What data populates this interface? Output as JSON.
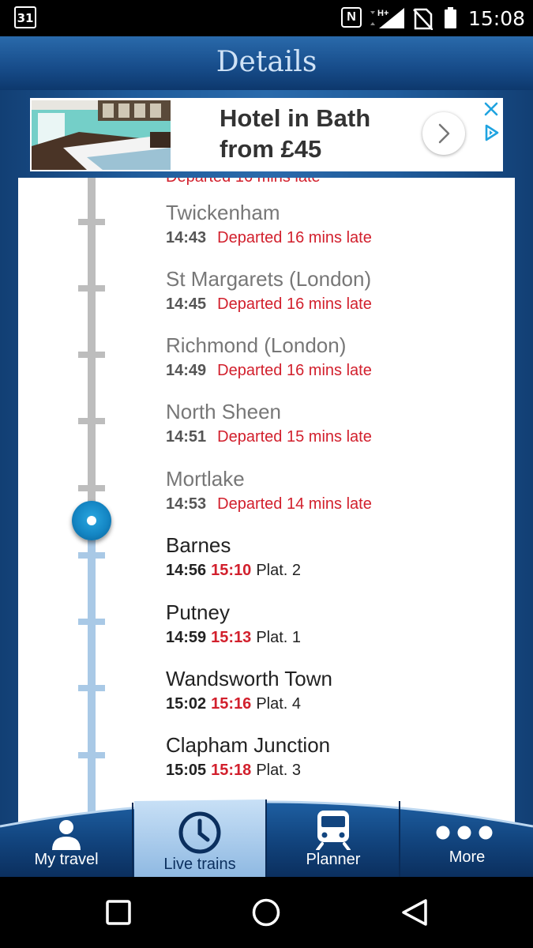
{
  "status_bar": {
    "calendar_day": "31",
    "nfc_letter": "N",
    "network_type": "H+",
    "time": "15:08"
  },
  "header": {
    "title": "Details"
  },
  "ad": {
    "headline_line1": "Hotel in Bath",
    "headline_line2": "from £45",
    "icons": [
      "hotel-room-photo",
      "chevron-right-icon",
      "close-icon",
      "adchoices-icon"
    ]
  },
  "timeline": {
    "cut_off_text": "Departed 16 mins late",
    "past_stops": [
      {
        "name": "Twickenham",
        "time": "14:43",
        "status": "Departed 16 mins late"
      },
      {
        "name": "St Margarets (London)",
        "time": "14:45",
        "status": "Departed 16 mins late"
      },
      {
        "name": "Richmond (London)",
        "time": "14:49",
        "status": "Departed 16 mins late"
      },
      {
        "name": "North Sheen",
        "time": "14:51",
        "status": "Departed 15 mins late"
      },
      {
        "name": "Mortlake",
        "time": "14:53",
        "status": "Departed 14 mins late"
      }
    ],
    "future_stops": [
      {
        "name": "Barnes",
        "scheduled": "14:56",
        "expected": "15:10",
        "platform": "Plat. 2"
      },
      {
        "name": "Putney",
        "scheduled": "14:59",
        "expected": "15:13",
        "platform": "Plat. 1"
      },
      {
        "name": "Wandsworth Town",
        "scheduled": "15:02",
        "expected": "15:16",
        "platform": "Plat. 4"
      },
      {
        "name": "Clapham Junction",
        "scheduled": "15:05",
        "expected": "15:18",
        "platform": "Plat. 3"
      }
    ],
    "colors": {
      "past_line": "#bdbdbd",
      "future_line": "#a9c9e6",
      "late": "#d2202d"
    }
  },
  "tabs": [
    {
      "label": "My travel",
      "icon": "person-icon",
      "selected": false
    },
    {
      "label": "Live trains",
      "icon": "clock-icon",
      "selected": true
    },
    {
      "label": "Planner",
      "icon": "train-icon",
      "selected": false
    },
    {
      "label": "More",
      "icon": "more-dots-icon",
      "selected": false
    }
  ],
  "nav": {
    "icons": [
      "recents-square-icon",
      "home-circle-icon",
      "back-triangle-icon"
    ]
  }
}
